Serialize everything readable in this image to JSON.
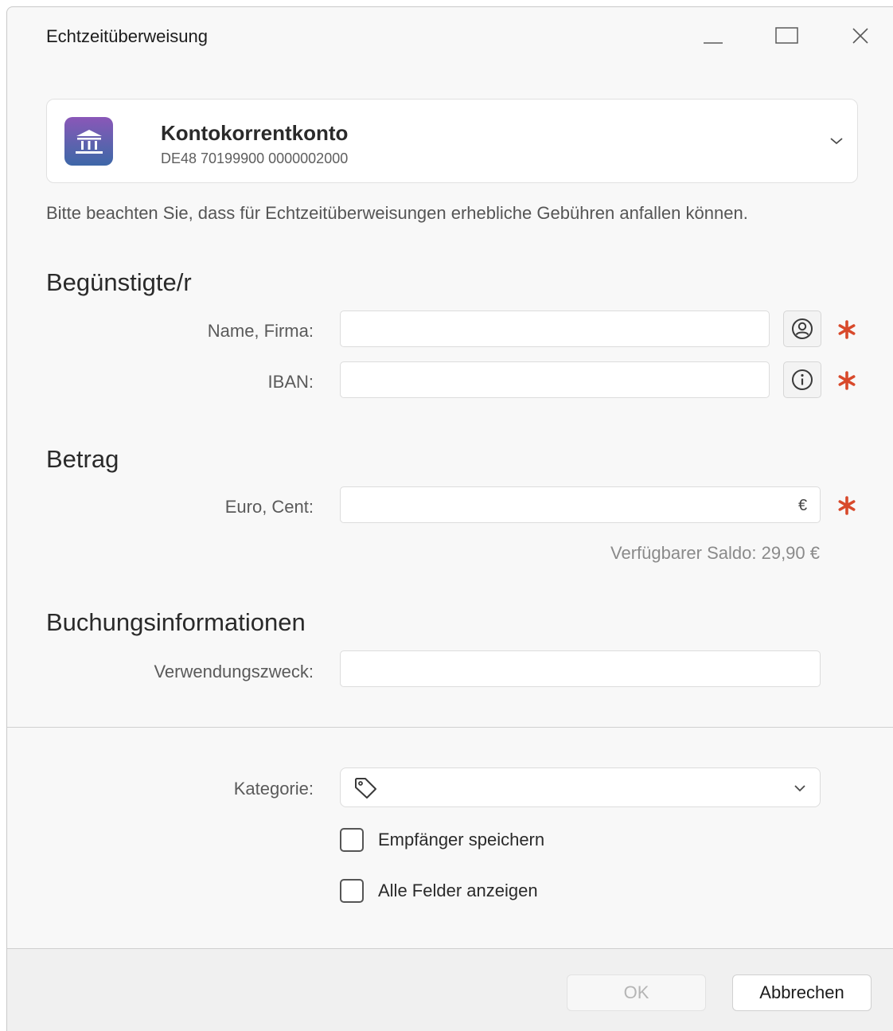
{
  "window": {
    "title": "Echtzeitüberweisung"
  },
  "account": {
    "name": "Kontokorrentkonto",
    "iban": "DE48 70199900 0000002000",
    "icon": "bank-icon",
    "icon_gradient": [
      "#8a57b8",
      "#3e67a8"
    ]
  },
  "notice": "Bitte beachten Sie, dass für Echtzeitüberweisungen erhebliche Gebühren anfallen können.",
  "beneficiary": {
    "section_title": "Begünstigte/r",
    "name_label": "Name, Firma:",
    "name_value": "",
    "name_button_icon": "contact-icon",
    "iban_label": "IBAN:",
    "iban_value": "",
    "iban_button_icon": "info-icon"
  },
  "amount": {
    "section_title": "Betrag",
    "label": "Euro, Cent:",
    "value": "",
    "currency": "€",
    "balance_text": "Verfügbarer Saldo: 29,90 €"
  },
  "booking": {
    "section_title": "Buchungsinformationen",
    "purpose_label": "Verwendungszweck:",
    "purpose_value": ""
  },
  "category": {
    "label": "Kategorie:",
    "value": "",
    "icon": "tag-icon"
  },
  "options": {
    "save_recipient_label": "Empfänger speichern",
    "save_recipient_checked": false,
    "show_all_fields_label": "Alle Felder anzeigen",
    "show_all_fields_checked": false
  },
  "footer": {
    "ok_label": "OK",
    "ok_enabled": false,
    "cancel_label": "Abbrechen"
  },
  "colors": {
    "required_marker": "#d8492b",
    "window_background": "#f8f8f8",
    "footer_background": "#f0f0f0"
  }
}
